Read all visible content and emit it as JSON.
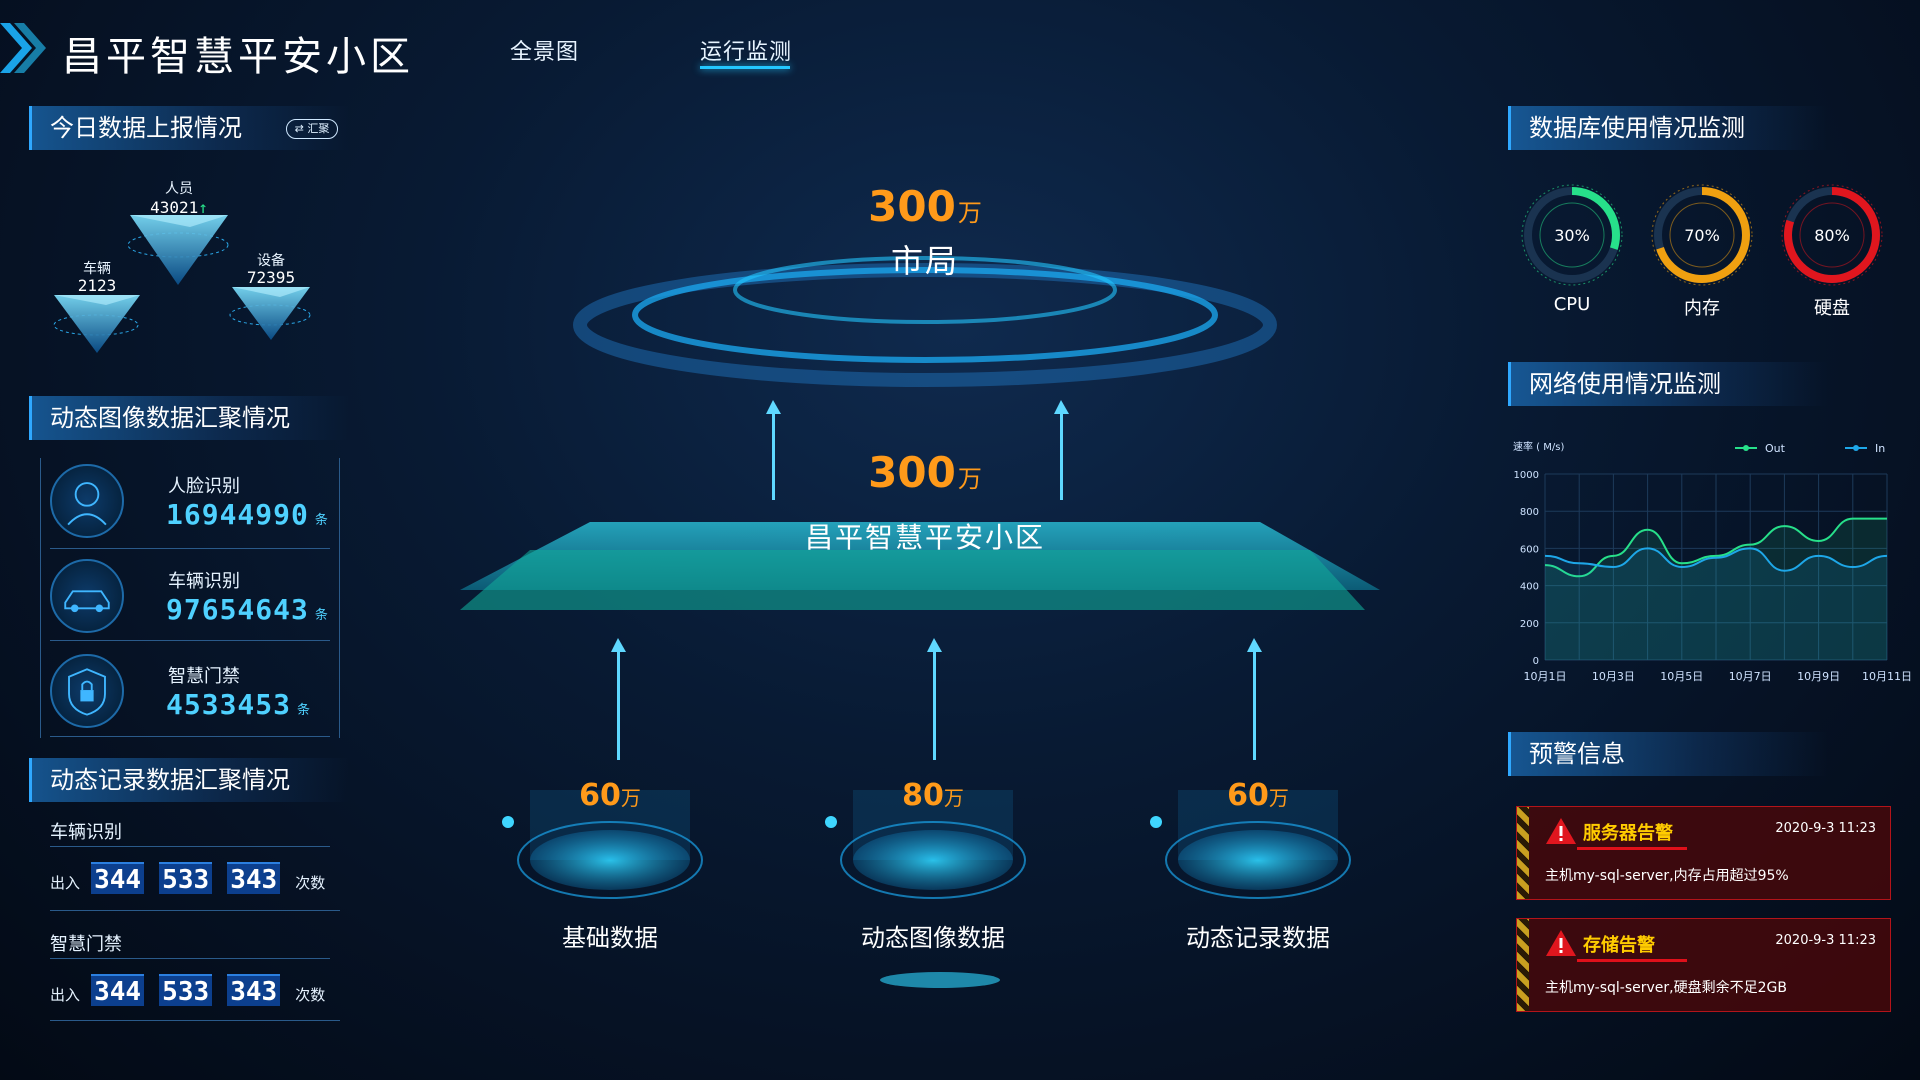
{
  "header": {
    "title": "昌平智慧平安小区",
    "nav": [
      {
        "label": "全景图",
        "active": false
      },
      {
        "label": "运行监测",
        "active": true
      }
    ]
  },
  "left": {
    "report_section": {
      "title": "今日数据上报情况",
      "badge": "⇄ 汇聚",
      "pyramids": [
        {
          "label": "人员",
          "value": "43021",
          "trend": "up"
        },
        {
          "label": "车辆",
          "value": "2123"
        },
        {
          "label": "设备",
          "value": "72395"
        }
      ]
    },
    "image_section": {
      "title": "动态图像数据汇聚情况",
      "items": [
        {
          "label": "人脸识别",
          "value": "16944990",
          "unit": "条",
          "icon": "face-icon"
        },
        {
          "label": "车辆识别",
          "value": "97654643",
          "unit": "条",
          "icon": "car-icon"
        },
        {
          "label": "智慧门禁",
          "value": "4533453",
          "unit": "条",
          "icon": "lock-shield-icon"
        }
      ]
    },
    "record_section": {
      "title": "动态记录数据汇聚情况",
      "rows": [
        {
          "title": "车辆识别",
          "prefix": "出入",
          "groups": [
            "344",
            "533",
            "343"
          ],
          "suffix": "次数"
        },
        {
          "title": "智慧门禁",
          "prefix": "出入",
          "groups": [
            "344",
            "533",
            "343"
          ],
          "suffix": "次数"
        }
      ]
    }
  },
  "center": {
    "top": {
      "value": "300",
      "unit": "万",
      "label": "市局"
    },
    "middle": {
      "value": "300",
      "unit": "万",
      "label": "昌平智慧平安小区"
    },
    "bases": [
      {
        "value": "60",
        "unit": "万",
        "label": "基础数据"
      },
      {
        "value": "80",
        "unit": "万",
        "label": "动态图像数据"
      },
      {
        "value": "60",
        "unit": "万",
        "label": "动态记录数据"
      }
    ]
  },
  "right": {
    "db_section": {
      "title": "数据库使用情况监测",
      "gauges": [
        {
          "label": "CPU",
          "percent": 30,
          "display": "30%",
          "color": "#27e08a"
        },
        {
          "label": "内存",
          "percent": 70,
          "display": "70%",
          "color": "#f0a010"
        },
        {
          "label": "硬盘",
          "percent": 80,
          "display": "80%",
          "color": "#e0161e"
        }
      ]
    },
    "network_section": {
      "title": "网络使用情况监测"
    },
    "alert_section": {
      "title": "预警信息",
      "alerts": [
        {
          "title": "服务器告警",
          "time": "2020-9-3 11:23",
          "message": "主机my-sql-server,内存占用超过95%"
        },
        {
          "title": "存储告警",
          "time": "2020-9-3 11:23",
          "message": "主机my-sql-server,硬盘剩余不足2GB"
        }
      ]
    }
  },
  "chart_data": {
    "type": "line",
    "ylabel": "速率 ( M/s)",
    "ylim": [
      0,
      1000
    ],
    "yticks": [
      "0",
      "200",
      "400",
      "600",
      "800",
      "1000"
    ],
    "x": [
      "10月1日",
      "10月3日",
      "10月5日",
      "10月7日",
      "10月9日",
      "10月11日"
    ],
    "legend": "top-right",
    "grid": true,
    "series": [
      {
        "name": "Out",
        "color": "#27e08a",
        "values": [
          510,
          450,
          560,
          700,
          520,
          560,
          620,
          720,
          640,
          760,
          760
        ]
      },
      {
        "name": "In",
        "color": "#1ea7e8",
        "values": [
          560,
          520,
          500,
          600,
          500,
          550,
          600,
          480,
          560,
          500,
          560
        ]
      }
    ]
  }
}
